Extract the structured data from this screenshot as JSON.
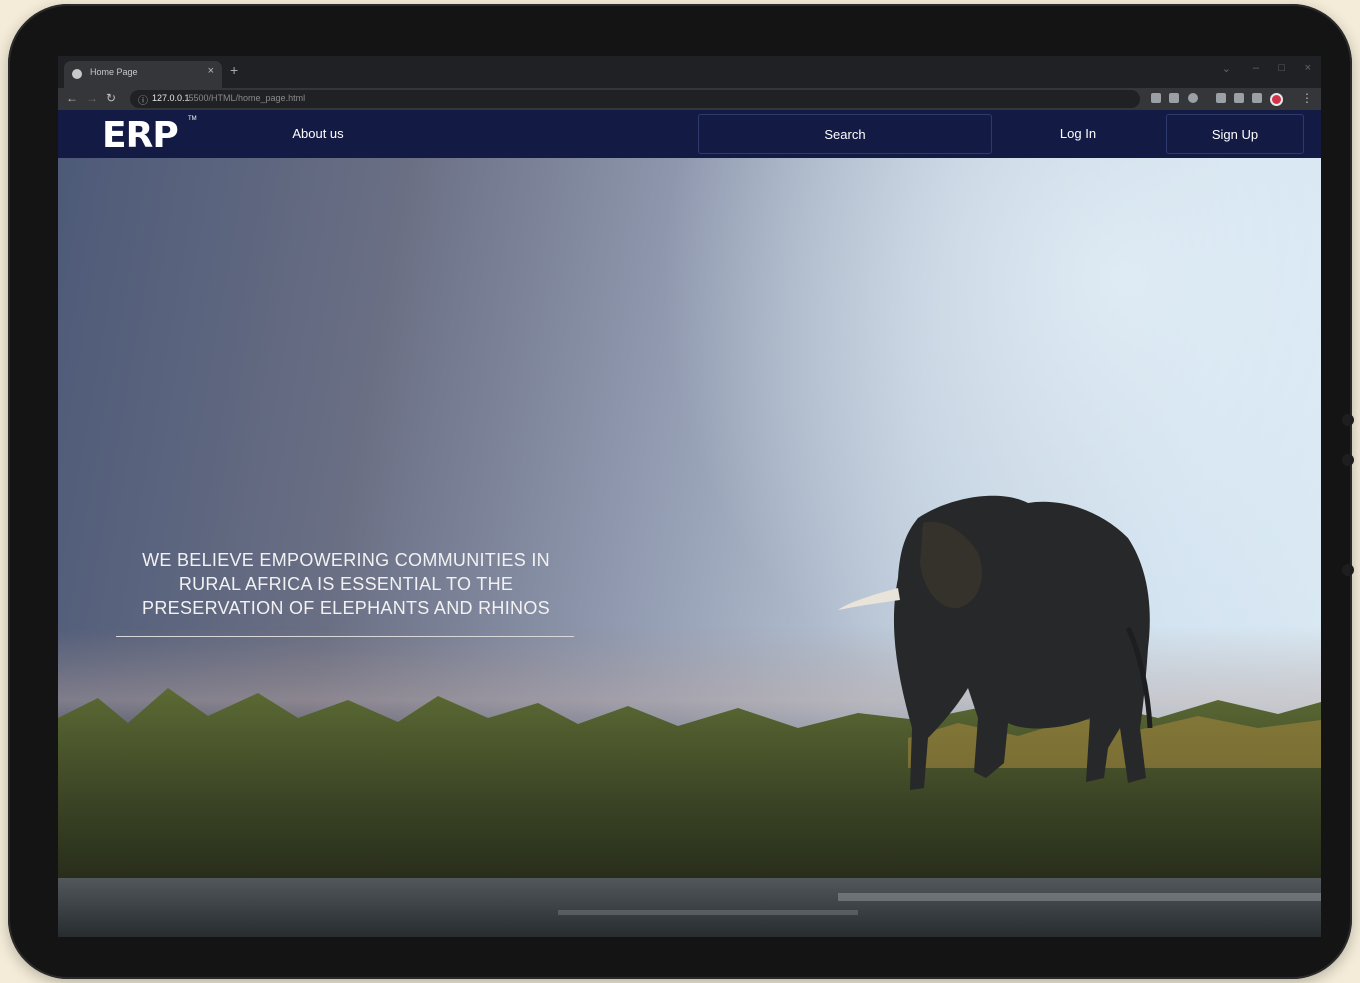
{
  "browser": {
    "tab_title": "Home Page",
    "tab_close": "×",
    "new_tab": "+",
    "url_host": "127.0.0.1",
    "url_path": ":5500/HTML/home_page.html"
  },
  "navbar": {
    "logo": "ERP",
    "logo_tm": "TM",
    "about_label": "About us",
    "search_label": "Search",
    "login_label": "Log In",
    "signup_label": "Sign Up",
    "bg_color": "#131b45"
  },
  "hero": {
    "headline": "WE BELIEVE EMPOWERING COMMUNITIES IN RURAL AFRICA IS ESSENTIAL TO THE PRESERVATION OF ELEPHANTS AND RHINOS",
    "image_subject": "elephant-at-dusk"
  }
}
